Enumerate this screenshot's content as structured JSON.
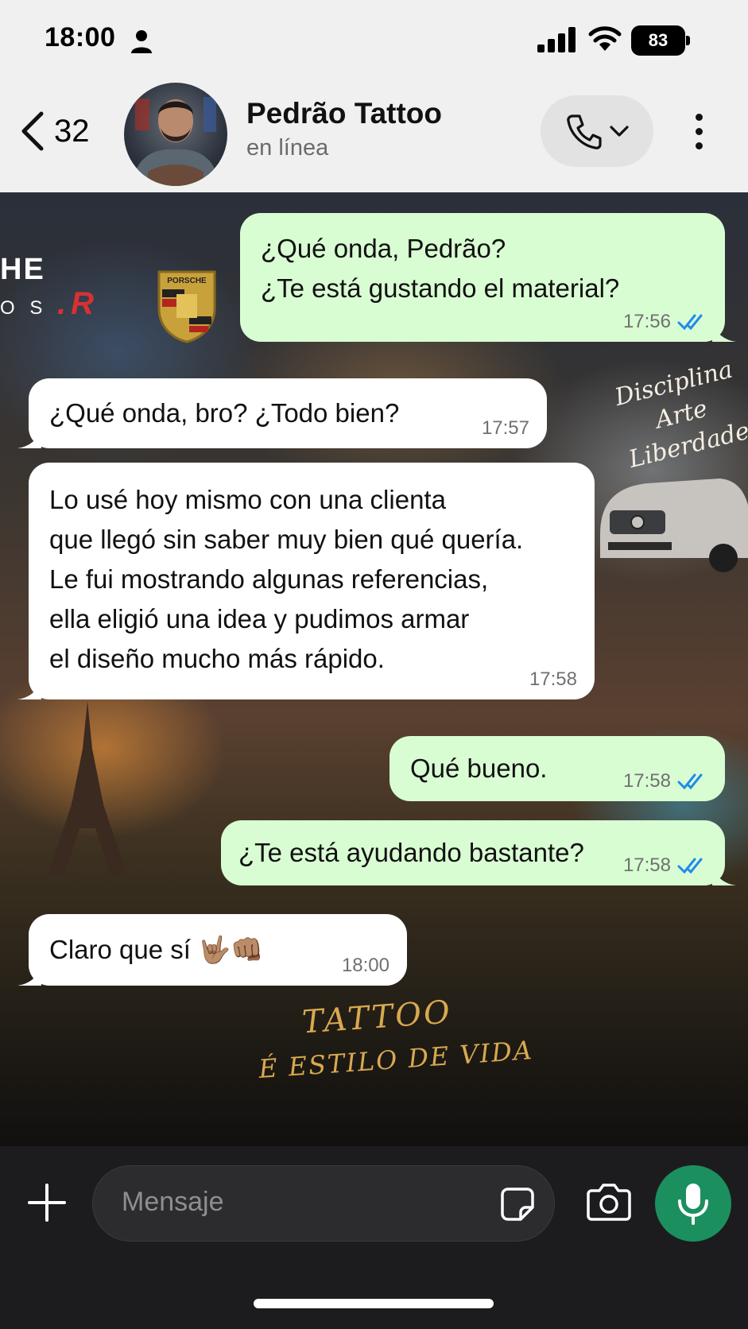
{
  "status_bar": {
    "time": "18:00",
    "battery": "83"
  },
  "header": {
    "back_count": "32",
    "contact_name": "Pedrão Tattoo",
    "contact_status": "en línea"
  },
  "wallpaper": {
    "motto_1": "Disciplina",
    "motto_2": "Arte",
    "motto_3": "Liberdade",
    "tattoo": "TATTOO",
    "estilo": "É ESTILO DE VIDA",
    "brand": "HE",
    "brand_sub": "O S",
    "brand_mark": ".R",
    "porsche": "PORSCHE"
  },
  "messages": [
    {
      "direction": "out",
      "text": "¿Qué onda, Pedrão?\n¿Te está gustando el material?",
      "time": "17:56",
      "read": true
    },
    {
      "direction": "in",
      "text": "¿Qué onda, bro? ¿Todo bien?",
      "time": "17:57"
    },
    {
      "direction": "in",
      "text": "Lo usé hoy mismo con una clienta\nque llegó sin saber muy bien qué quería.\nLe fui mostrando algunas referencias,\nella eligió una idea y pudimos armar\nel diseño mucho más rápido.",
      "time": "17:58"
    },
    {
      "direction": "out",
      "text": "Qué bueno.",
      "time": "17:58",
      "read": true
    },
    {
      "direction": "out",
      "text": "¿Te está ayudando bastante?",
      "time": "17:58",
      "read": true
    },
    {
      "direction": "in",
      "text": "Claro que sí 🤟🏽👊🏽",
      "time": "18:00"
    }
  ],
  "input": {
    "placeholder": "Mensaje"
  },
  "colors": {
    "outgoing": "#d9fdd3",
    "incoming": "#ffffff",
    "read_ticks": "#1f8ceb",
    "mic": "#1c8f5f"
  }
}
